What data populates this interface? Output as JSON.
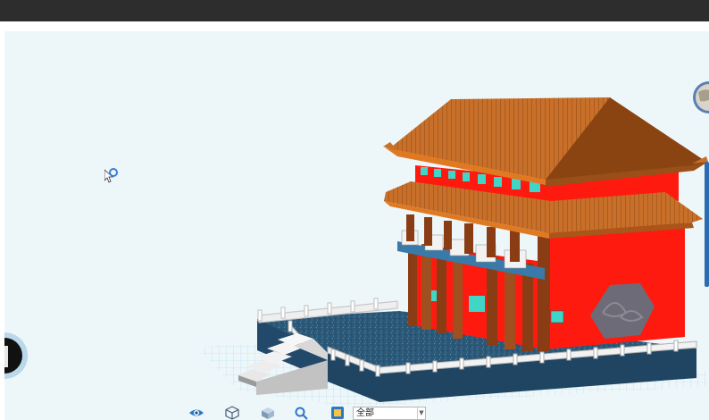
{
  "toolbar": {
    "view_filter_selected": "全部",
    "icons": [
      "eye-icon",
      "cube-wireframe-icon",
      "cube-solid-icon",
      "search-icon",
      "layers-icon"
    ]
  },
  "colors": {
    "wall": "#ff1a10",
    "roof": "#c8702a",
    "column": "#8a3d14",
    "window": "#3fd6c8",
    "platform": "#2c5878",
    "railing": "#e6e6e6",
    "grid": "#bfe6f2"
  }
}
